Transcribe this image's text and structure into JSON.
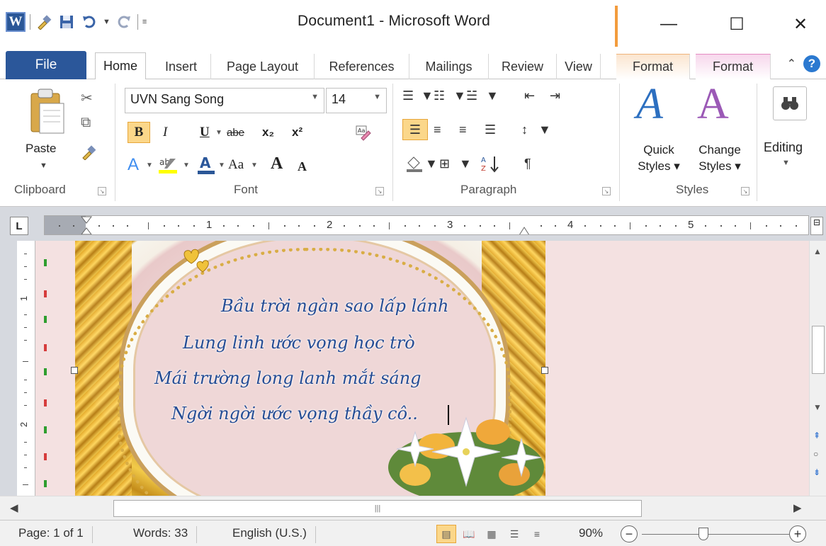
{
  "window": {
    "title": "Document1 - Microsoft Word",
    "logo_letter": "W",
    "minimize": "—",
    "maximize": "☐",
    "close": "✕"
  },
  "quick_access": {
    "icons": [
      "format-painter-icon",
      "save-icon",
      "undo-icon",
      "redo-icon",
      "customize-icon"
    ]
  },
  "tabs": {
    "file": "File",
    "items": [
      "Home",
      "Insert",
      "Page Layout",
      "References",
      "Mailings",
      "Review",
      "View"
    ],
    "context1": "Format",
    "context2": "Format",
    "help": "?"
  },
  "ribbon": {
    "clipboard": {
      "paste": "Paste",
      "label": "Clipboard"
    },
    "font": {
      "name": "UVN Sang Song",
      "size": "14",
      "bold": "B",
      "italic": "I",
      "underline": "U",
      "strike": "abe",
      "subscript": "x₂",
      "superscript": "x²",
      "grow": "A",
      "shrink": "A",
      "case": "Aa",
      "label": "Font"
    },
    "paragraph": {
      "label": "Paragraph",
      "pilcrow": "¶"
    },
    "styles": {
      "quick": "Quick",
      "quick2": "Styles ▾",
      "change": "Change",
      "change2": "Styles ▾",
      "label": "Styles"
    },
    "editing": {
      "label": "Editing"
    }
  },
  "ruler": {
    "numbers": [
      "1",
      "2",
      "3",
      "4",
      "5"
    ],
    "tab_glyph": "L"
  },
  "vruler": {
    "numbers": [
      "1",
      "2"
    ]
  },
  "document": {
    "poem": [
      "Bầu trời ngàn sao lấp lánh",
      "Lung linh ước vọng học trò",
      "Mái trường long lanh mắt sáng",
      "Ngời ngời ước vọng thầy cô.."
    ]
  },
  "status": {
    "page": "Page: 1 of 1",
    "words": "Words: 33",
    "language": "English (U.S.)",
    "zoom": "90%",
    "zoom_minus": "−",
    "zoom_plus": "+",
    "zoom_level": 0.42
  },
  "colors": {
    "file_tab": "#2b579a",
    "highlight": "#fbd78a",
    "poem_text": "#254c94",
    "doc_bg": "#f4e1e1"
  }
}
